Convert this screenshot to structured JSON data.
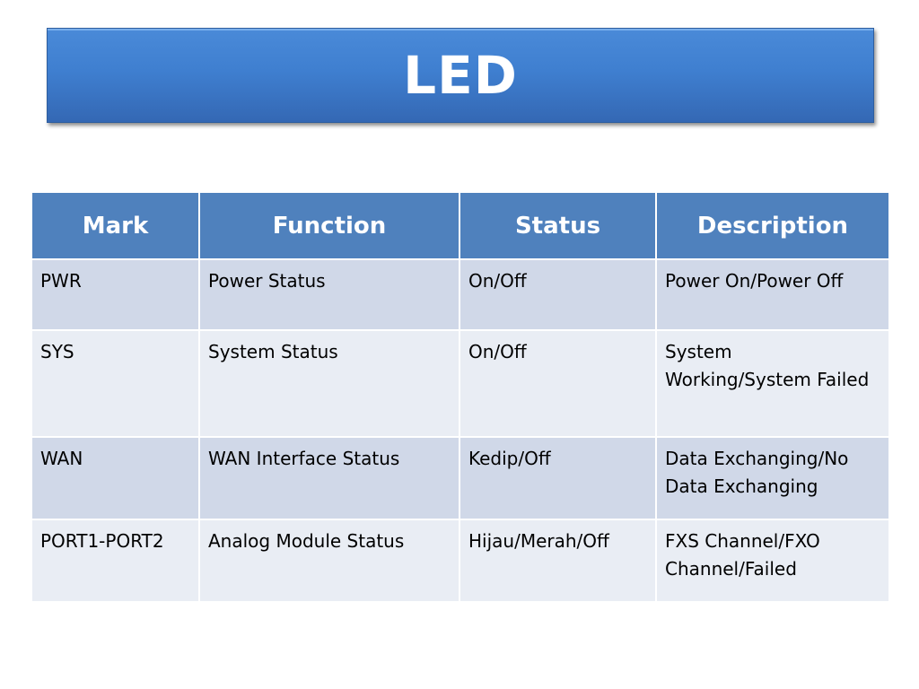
{
  "slide": {
    "title": "LED"
  },
  "colors": {
    "title_bar": "#3f7fd0",
    "header_bg": "#4f81bd",
    "row_odd_bg": "#d0d8e8",
    "row_even_bg": "#e9edf4"
  },
  "table": {
    "headers": [
      "Mark",
      "Function",
      "Status",
      "Description"
    ],
    "rows": [
      [
        "PWR",
        "Power Status",
        "On/Off",
        "Power On/Power Off"
      ],
      [
        "SYS",
        "System Status",
        "On/Off",
        "System Working/System Failed"
      ],
      [
        "WAN",
        "WAN Interface Status",
        "Kedip/Off",
        "Data Exchanging/No Data Exchanging"
      ],
      [
        "PORT1-PORT2",
        "Analog Module Status",
        "Hijau/Merah/Off",
        "FXS Channel/FXO Channel/Failed"
      ]
    ]
  }
}
